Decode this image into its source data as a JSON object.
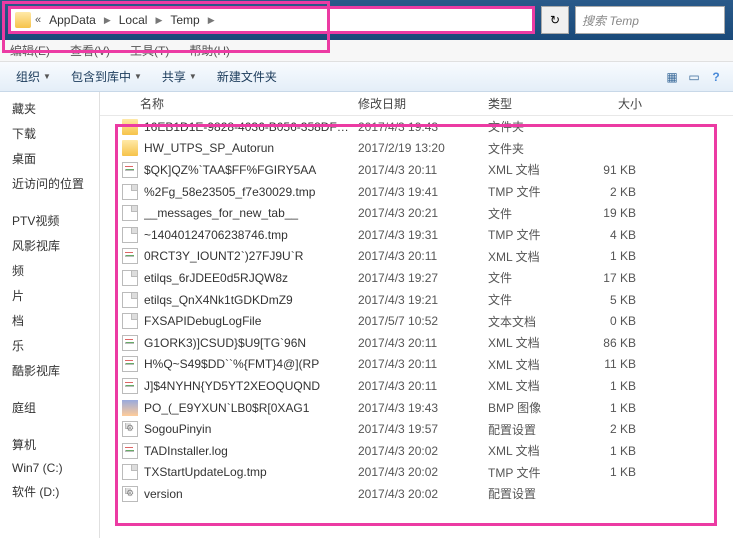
{
  "address": {
    "chevrons": "«",
    "crumbs": [
      "AppData",
      "Local",
      "Temp"
    ]
  },
  "search": {
    "placeholder": "搜索 Temp"
  },
  "menu": {
    "edit": "编辑(E)",
    "view": "查看(V)",
    "tools": "工具(T)",
    "help": "帮助(H)"
  },
  "toolbar": {
    "organize": "组织",
    "include": "包含到库中",
    "share": "共享",
    "newfolder": "新建文件夹"
  },
  "sidebar": {
    "favorites_items": [
      "藏夹",
      "下载",
      "桌面",
      "近访问的位置"
    ],
    "libs": [
      "PTV视频",
      "风影视库",
      "频",
      "片",
      "档",
      "乐",
      "酷影视库"
    ],
    "homegroup": "庭组",
    "computer": [
      "算机",
      "Win7 (C:)",
      "软件 (D:)"
    ]
  },
  "columns": {
    "name": "名称",
    "date": "修改日期",
    "type": "类型",
    "size": "大小"
  },
  "rows": [
    {
      "ic": "folder",
      "name": "16EB1D1E-9828-4036-B056-358DFF8...",
      "date": "2017/4/3 19:43",
      "type": "文件夹",
      "size": ""
    },
    {
      "ic": "folder",
      "name": "HW_UTPS_SP_Autorun",
      "date": "2017/2/19 13:20",
      "type": "文件夹",
      "size": ""
    },
    {
      "ic": "xml",
      "name": "$QK]QZ%`TAA$FF%FGIRY5AA",
      "date": "2017/4/3 20:11",
      "type": "XML 文档",
      "size": "91 KB"
    },
    {
      "ic": "file",
      "name": "%2Fg_58e23505_f7e30029.tmp",
      "date": "2017/4/3 19:41",
      "type": "TMP 文件",
      "size": "2 KB"
    },
    {
      "ic": "file",
      "name": "__messages_for_new_tab__",
      "date": "2017/4/3 20:21",
      "type": "文件",
      "size": "19 KB"
    },
    {
      "ic": "file",
      "name": "~14040124706238746.tmp",
      "date": "2017/4/3 19:31",
      "type": "TMP 文件",
      "size": "4 KB"
    },
    {
      "ic": "xml",
      "name": "0RCT3Y_IOUNT2`)27FJ9U`R",
      "date": "2017/4/3 20:11",
      "type": "XML 文档",
      "size": "1 KB"
    },
    {
      "ic": "file",
      "name": "etilqs_6rJDEE0d5RJQW8z",
      "date": "2017/4/3 19:27",
      "type": "文件",
      "size": "17 KB"
    },
    {
      "ic": "file",
      "name": "etilqs_QnX4Nk1tGDKDmZ9",
      "date": "2017/4/3 19:21",
      "type": "文件",
      "size": "5 KB"
    },
    {
      "ic": "txt",
      "name": "FXSAPIDebugLogFile",
      "date": "2017/5/7 10:52",
      "type": "文本文档",
      "size": "0 KB"
    },
    {
      "ic": "xml",
      "name": "G1ORK3)]CSUD}$U9[TG`96N",
      "date": "2017/4/3 20:11",
      "type": "XML 文档",
      "size": "86 KB"
    },
    {
      "ic": "xml",
      "name": "H%Q~S49$DD``%{FMT}4@](RP",
      "date": "2017/4/3 20:11",
      "type": "XML 文档",
      "size": "11 KB"
    },
    {
      "ic": "xml",
      "name": "J]$4NYHN{YD5YT2XEOQUQND",
      "date": "2017/4/3 20:11",
      "type": "XML 文档",
      "size": "1 KB"
    },
    {
      "ic": "bmp",
      "name": "PO_(_E9YXUN`LB0$R[0XAG1",
      "date": "2017/4/3 19:43",
      "type": "BMP 图像",
      "size": "1 KB"
    },
    {
      "ic": "cfg",
      "name": "SogouPinyin",
      "date": "2017/4/3 19:57",
      "type": "配置设置",
      "size": "2 KB"
    },
    {
      "ic": "xml",
      "name": "TADInstaller.log",
      "date": "2017/4/3 20:02",
      "type": "XML 文档",
      "size": "1 KB"
    },
    {
      "ic": "file",
      "name": "TXStartUpdateLog.tmp",
      "date": "2017/4/3 20:02",
      "type": "TMP 文件",
      "size": "1 KB"
    },
    {
      "ic": "cfg",
      "name": "version",
      "date": "2017/4/3 20:02",
      "type": "配置设置",
      "size": ""
    }
  ]
}
